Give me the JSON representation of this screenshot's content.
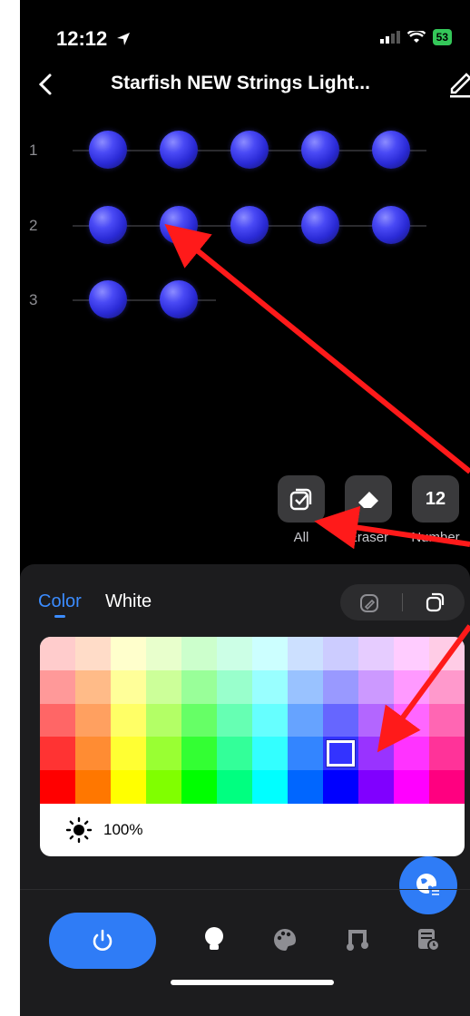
{
  "status": {
    "time": "12:12",
    "battery": "53"
  },
  "header": {
    "title": "Starfish NEW Strings Light..."
  },
  "rows": [
    {
      "label": "1",
      "count": 5
    },
    {
      "label": "2",
      "count": 5
    },
    {
      "label": "3",
      "count": 2
    }
  ],
  "tools": [
    {
      "label": "All",
      "icon": "select-all-icon"
    },
    {
      "label": "Eraser",
      "icon": "eraser-icon"
    },
    {
      "label": "Number",
      "icon": "number-icon",
      "value": "12"
    }
  ],
  "tabs": {
    "color": "Color",
    "white": "White"
  },
  "brightness": "100%",
  "colors": {
    "bulb": "#3434e8",
    "accent": "#2f7cf6",
    "arrow": "#ff1a1a",
    "palette": [
      [
        "#ffcccc",
        "#ffdcc8",
        "#ffffcc",
        "#e8ffcc",
        "#ccffcc",
        "#ccffe6",
        "#ccffff",
        "#cce0ff",
        "#ccccff",
        "#e6ccff",
        "#ffccff",
        "#ffcce6"
      ],
      [
        "#ff9999",
        "#ffbb88",
        "#ffff99",
        "#ccff99",
        "#99ff99",
        "#99ffcc",
        "#99ffff",
        "#99c2ff",
        "#9999ff",
        "#cc99ff",
        "#ff99ff",
        "#ff99cc"
      ],
      [
        "#ff6666",
        "#ffa060",
        "#ffff66",
        "#b3ff66",
        "#66ff66",
        "#66ffb3",
        "#66ffff",
        "#66a3ff",
        "#6666ff",
        "#b366ff",
        "#ff66ff",
        "#ff66b3"
      ],
      [
        "#ff3333",
        "#ff8c33",
        "#ffff33",
        "#99ff33",
        "#33ff33",
        "#33ff99",
        "#33ffff",
        "#3385ff",
        "#3333ff",
        "#9933ff",
        "#ff33ff",
        "#ff3399"
      ],
      [
        "#ff0000",
        "#ff7700",
        "#ffff00",
        "#80ff00",
        "#00ff00",
        "#00ff80",
        "#00ffff",
        "#0066ff",
        "#0000ff",
        "#8000ff",
        "#ff00ff",
        "#ff0080"
      ]
    ],
    "selected": {
      "row": 3,
      "col": 8
    }
  }
}
